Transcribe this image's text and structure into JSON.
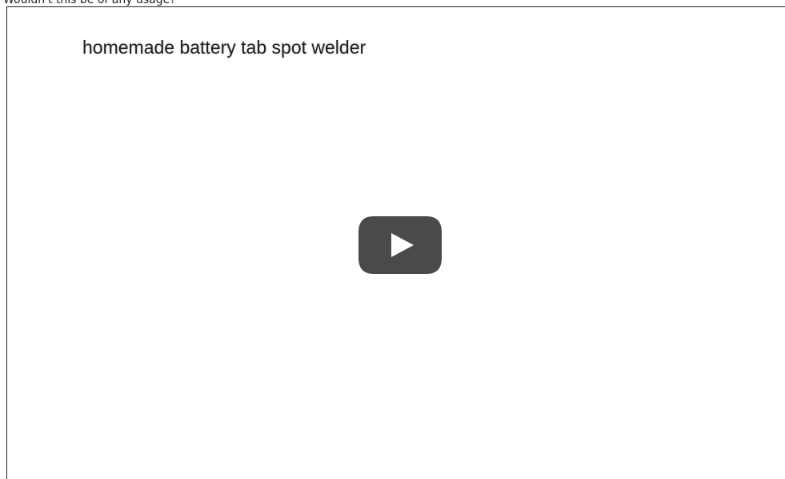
{
  "post": {
    "text": "Wouldn't this be of any usage?"
  },
  "video": {
    "title": "homemade battery tab spot welder",
    "play_button_color": "#4a4a4a",
    "play_icon_color": "#ffffff"
  }
}
